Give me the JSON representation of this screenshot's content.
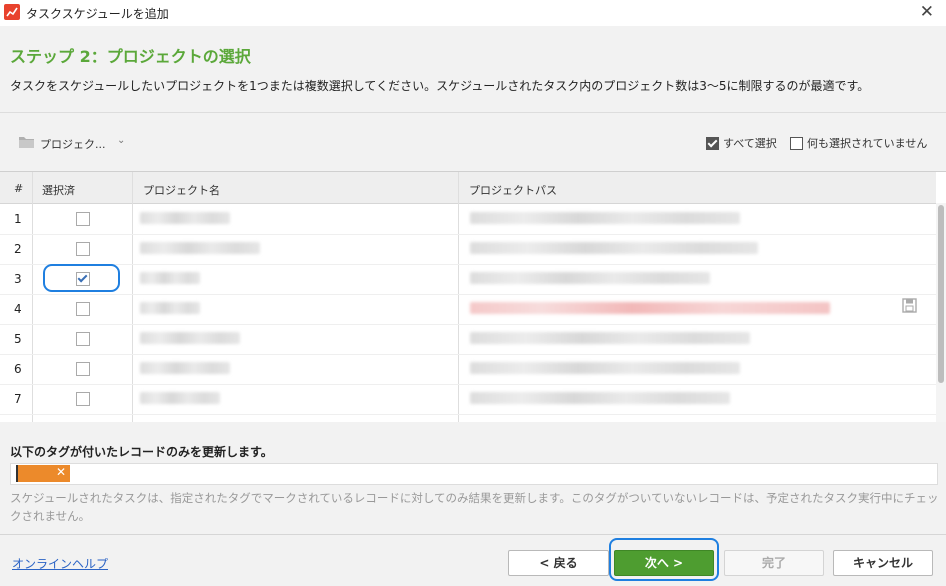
{
  "window": {
    "title": "タスクスケジュールを追加",
    "close_glyph": "✕"
  },
  "header": {
    "step_title": "ステップ 2：プロジェクトの選択",
    "description": "タスクをスケジュールしたいプロジェクトを1つまたは複数選択してください。スケジュールされたタスク内のプロジェクト数は3～5に制限するのが最適です。"
  },
  "toolbar": {
    "project_dropdown_label": "プロジェク...",
    "select_all_label": "すべて選択",
    "select_all_checked": true,
    "select_none_label": "何も選択されていません",
    "select_none_checked": false
  },
  "table": {
    "columns": [
      "#",
      "選択済",
      "プロジェクト名",
      "プロジェクトパス"
    ],
    "rows": [
      {
        "num": "1",
        "checked": false
      },
      {
        "num": "2",
        "checked": false
      },
      {
        "num": "3",
        "checked": true
      },
      {
        "num": "4",
        "checked": false
      },
      {
        "num": "5",
        "checked": false
      },
      {
        "num": "6",
        "checked": false
      },
      {
        "num": "7",
        "checked": false
      }
    ]
  },
  "tags": {
    "title": "以下のタグが付いたレコードのみを更新します。",
    "remove_glyph": "✕",
    "chip_color": "#ec8a2b",
    "note": "スケジュールされたタスクは、指定されたタグでマークされているレコードに対してのみ結果を更新します。このタグがついていないレコードは、予定されたタスク実行中にチェックされません。"
  },
  "footer": {
    "help_link": "オンラインヘルプ",
    "back_label": "< 戻る",
    "next_label": "次へ >",
    "finish_label": "完了",
    "cancel_label": "キャンセル"
  },
  "colors": {
    "accent_green": "#5ba83a",
    "primary_button": "#4e9d30",
    "highlight_outline": "#1f7fe0",
    "link": "#2b63c5"
  }
}
